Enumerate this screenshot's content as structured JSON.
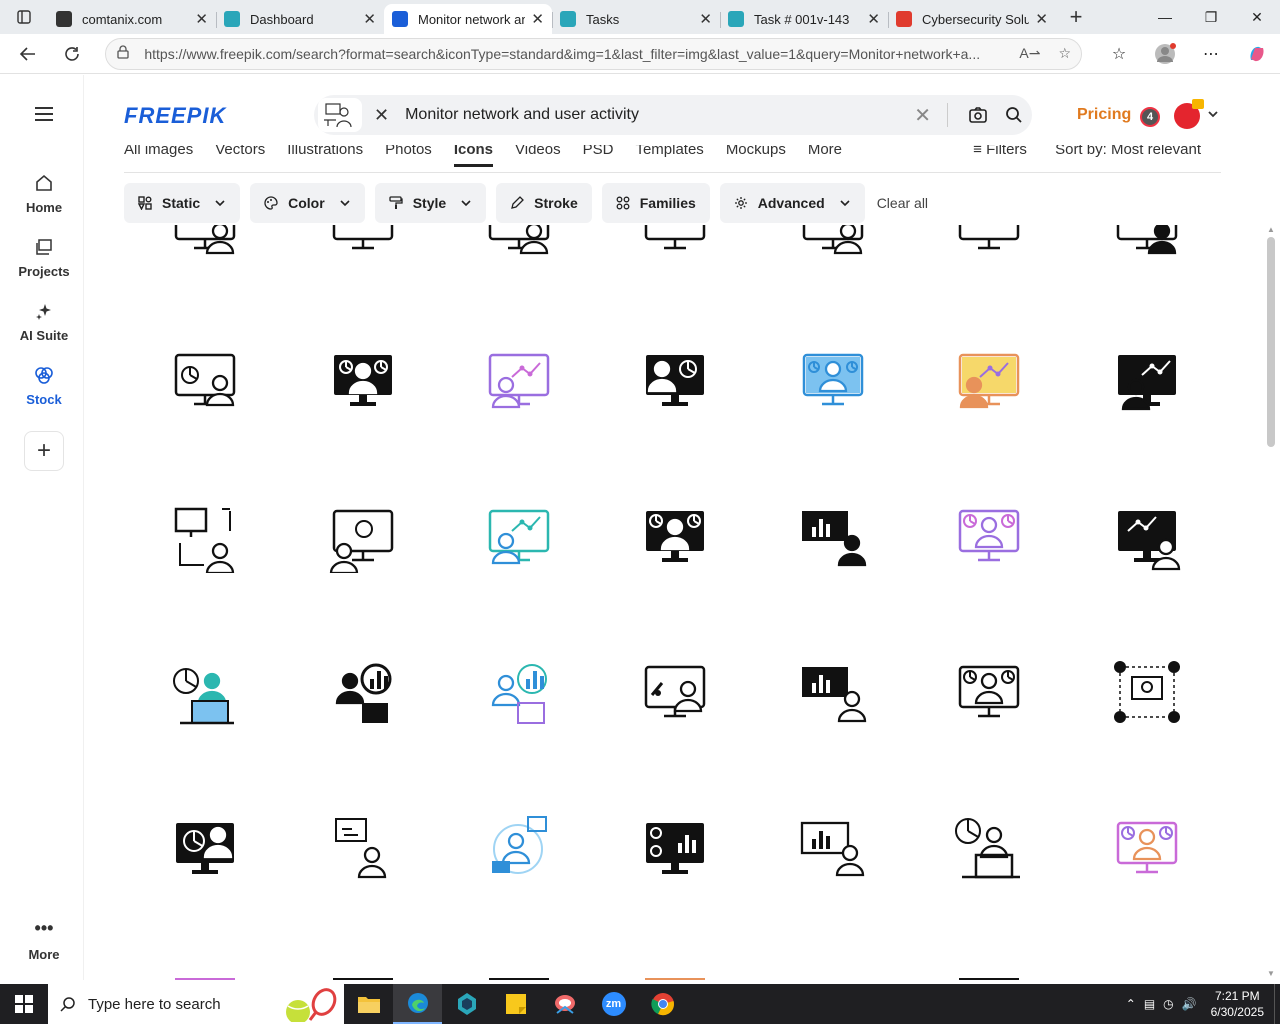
{
  "browser": {
    "tabs": [
      {
        "title": "comtanix.com",
        "active": false,
        "favicon_color": "#333333",
        "icon": "comtanix-icon"
      },
      {
        "title": "Dashboard",
        "active": false,
        "favicon_color": "#2aa6b9",
        "icon": "dashboard-favicon-icon"
      },
      {
        "title": "Monitor network and user activity",
        "active": true,
        "favicon_color": "#1a5ed8",
        "icon": "freepik-favicon-icon"
      },
      {
        "title": "Tasks",
        "active": false,
        "favicon_color": "#2aa6b9",
        "icon": "tasks-favicon-icon"
      },
      {
        "title": "Task # 001v-143",
        "active": false,
        "favicon_color": "#2aa6b9",
        "icon": "task-favicon-icon"
      },
      {
        "title": "Cybersecurity Soluti",
        "active": false,
        "favicon_color": "#e03b2e",
        "icon": "cyber-favicon-icon"
      }
    ],
    "url": "https://www.freepik.com/search?format=search&iconType=standard&img=1&last_filter=img&last_value=1&query=Monitor+network+a..."
  },
  "sidebar": {
    "items": [
      {
        "label": "Home",
        "icon": "home-icon"
      },
      {
        "label": "Projects",
        "icon": "projects-icon"
      },
      {
        "label": "AI Suite",
        "icon": "ai-sparkle-icon"
      },
      {
        "label": "Stock",
        "icon": "stock-icon"
      }
    ],
    "more_label": "More"
  },
  "header": {
    "logo": "FREEPIK",
    "search_query": "Monitor network and user activity",
    "pricing_label": "Pricing",
    "notification_count": "4"
  },
  "content_tabs": {
    "items": [
      "All images",
      "Vectors",
      "Illustrations",
      "Photos",
      "Icons",
      "Videos",
      "PSD",
      "Templates",
      "Mockups",
      "More"
    ],
    "active": "Icons",
    "filters_label": "Filters",
    "sort_label": "Sort by:",
    "sort_value": "Most relevant"
  },
  "filters": {
    "buttons": [
      {
        "label": "Static",
        "icon": "static-icon",
        "has_chevron": true
      },
      {
        "label": "Color",
        "icon": "palette-icon",
        "has_chevron": true
      },
      {
        "label": "Style",
        "icon": "brush-icon",
        "has_chevron": true
      },
      {
        "label": "Stroke",
        "icon": "pen-icon",
        "has_chevron": false
      },
      {
        "label": "Families",
        "icon": "grid-icon",
        "has_chevron": false
      },
      {
        "label": "Advanced",
        "icon": "gear-icon",
        "has_chevron": true
      }
    ],
    "clear_label": "Clear all"
  },
  "results": {
    "colors": {
      "black": "#111111",
      "blue": "#2f8fd8",
      "purple": "#9a6ee0",
      "gradient_pink": "#c96ad8",
      "orange": "#e8925a",
      "teal": "#2bb7b0"
    },
    "rows": [
      [
        "user-monitor-icon",
        "user-dashboard-monitor-icon",
        "analytics-user-icon",
        "dashboard-person-icon",
        "analytics-monitor-icon",
        "growth-chart-user-icon",
        "network-monitor-user-icon"
      ],
      [
        "network-user-icon",
        "screen-review-icon",
        "analytics-user-icon",
        "dashboard-monitor-icon",
        "bar-chart-user-icon",
        "dashboard-monitor-icon",
        "chart-monitor-user-icon"
      ],
      [
        "user-laptop-icon",
        "user-analytics-icon",
        "user-analytics-icon",
        "screen-user-icon",
        "bar-chart-user-icon",
        "dashboard-monitor-icon",
        "network-hub-icon"
      ],
      [
        "pie-chart-user-icon",
        "workflow-user-icon",
        "remote-user-icon",
        "user-security-monitor-icon",
        "bar-chart-user-icon",
        "user-laptop-icon",
        "dashboard-monitor-icon"
      ]
    ]
  },
  "taskbar": {
    "search_placeholder": "Type here to search",
    "time": "7:21 PM",
    "date": "6/30/2025",
    "apps": [
      "file-explorer-icon",
      "edge-icon",
      "app-icon",
      "sticky-notes-icon",
      "snipping-tool-icon",
      "zoom-icon",
      "chrome-icon"
    ],
    "zoom_label": "zm"
  }
}
